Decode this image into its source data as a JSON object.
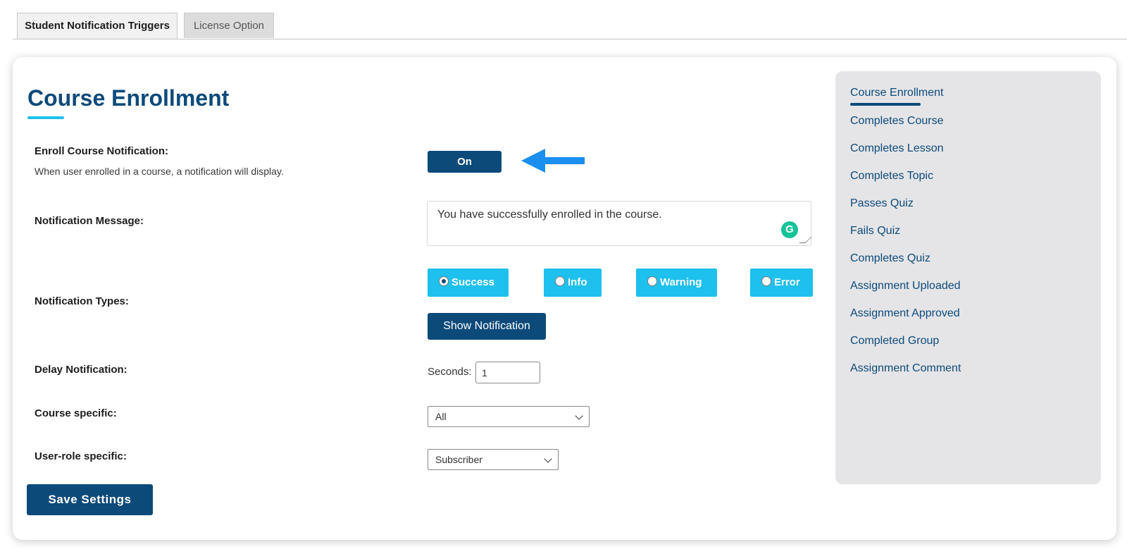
{
  "tabs": [
    {
      "label": "Student Notification Triggers",
      "active": true
    },
    {
      "label": "License Option",
      "active": false
    }
  ],
  "main": {
    "title": "Course Enrollment",
    "enroll": {
      "label": "Enroll Course Notification:",
      "description": "When user enrolled in a course, a notification will display.",
      "toggle_label": "On"
    },
    "message": {
      "label": "Notification Message:",
      "value": "You have successfully enrolled in the course.",
      "grammarly_icon": "G"
    },
    "types": {
      "label": "Notification Types:",
      "options": [
        {
          "label": "Success",
          "checked": true
        },
        {
          "label": "Info",
          "checked": false
        },
        {
          "label": "Warning",
          "checked": false
        },
        {
          "label": "Error",
          "checked": false
        }
      ],
      "show_button": "Show Notification"
    },
    "delay": {
      "label": "Delay Notification:",
      "seconds_label": "Seconds:",
      "value": "1"
    },
    "course_specific": {
      "label": "Course specific:",
      "selected": "All"
    },
    "role_specific": {
      "label": "User-role specific:",
      "selected": "Subscriber"
    },
    "save_button": "Save Settings"
  },
  "sidebar": {
    "items": [
      {
        "label": "Course Enrollment",
        "active": true
      },
      {
        "label": "Completes Course"
      },
      {
        "label": "Completes Lesson"
      },
      {
        "label": "Completes Topic"
      },
      {
        "label": "Passes Quiz"
      },
      {
        "label": "Fails Quiz"
      },
      {
        "label": "Completes Quiz"
      },
      {
        "label": "Assignment Uploaded"
      },
      {
        "label": "Assignment Approved"
      },
      {
        "label": "Completed Group"
      },
      {
        "label": "Assignment Comment"
      }
    ]
  },
  "colors": {
    "brand_dark": "#0c4a7a",
    "accent_cyan": "#1ec0ee",
    "arrow_blue": "#1a8ff0",
    "sidebar_bg": "#e5e5e8"
  },
  "icons": {
    "arrow": "left-arrow-icon",
    "grammarly": "grammarly-icon",
    "chevron": "chevron-down-icon"
  }
}
